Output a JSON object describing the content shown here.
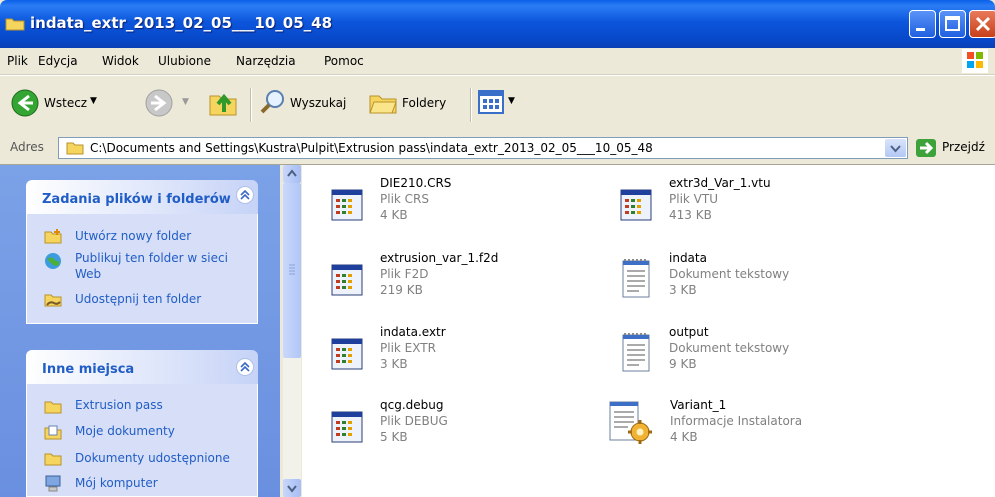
{
  "window": {
    "title": "indata_extr_2013_02_05___10_05_48"
  },
  "menu": [
    "Plik",
    "Edycja",
    "Widok",
    "Ulubione",
    "Narzędzia",
    "Pomoc"
  ],
  "toolbar": {
    "back_label": "Wstecz",
    "search_label": "Wyszukaj",
    "folders_label": "Foldery"
  },
  "address": {
    "label": "Adres",
    "path": "C:\\Documents and Settings\\Kustra\\Pulpit\\Extrusion pass\\indata_extr_2013_02_05___10_05_48",
    "go_label": "Przejdź"
  },
  "tasks_panel": {
    "title": "Zadania plików i folderów",
    "items": [
      "Utwórz nowy folder",
      "Publikuj ten folder w sieci",
      "Web",
      "Udostępnij ten folder"
    ]
  },
  "places_panel": {
    "title": "Inne miejsca",
    "items": [
      "Extrusion pass",
      "Moje dokumenty",
      "Dokumenty udostępnione",
      "Mój komputer"
    ]
  },
  "files": [
    {
      "name": "DIE210.CRS",
      "type": "Plik CRS",
      "size": "4 KB",
      "icon": "app-window-icon"
    },
    {
      "name": "extr3d_Var_1.vtu",
      "type": "Plik VTU",
      "size": "413 KB",
      "icon": "app-window-icon"
    },
    {
      "name": "extrusion_var_1.f2d",
      "type": "Plik F2D",
      "size": "219 KB",
      "icon": "app-window-icon"
    },
    {
      "name": "indata",
      "type": "Dokument tekstowy",
      "size": "3 KB",
      "icon": "notepad-icon"
    },
    {
      "name": "indata.extr",
      "type": "Plik EXTR",
      "size": "3 KB",
      "icon": "app-window-icon"
    },
    {
      "name": "output",
      "type": "Dokument tekstowy",
      "size": "9 KB",
      "icon": "notepad-icon"
    },
    {
      "name": "qcg.debug",
      "type": "Plik DEBUG",
      "size": "5 KB",
      "icon": "app-window-icon"
    },
    {
      "name": "Variant_1",
      "type": "Informacje Instalatora",
      "size": "4 KB",
      "icon": "setup-info-icon"
    }
  ]
}
